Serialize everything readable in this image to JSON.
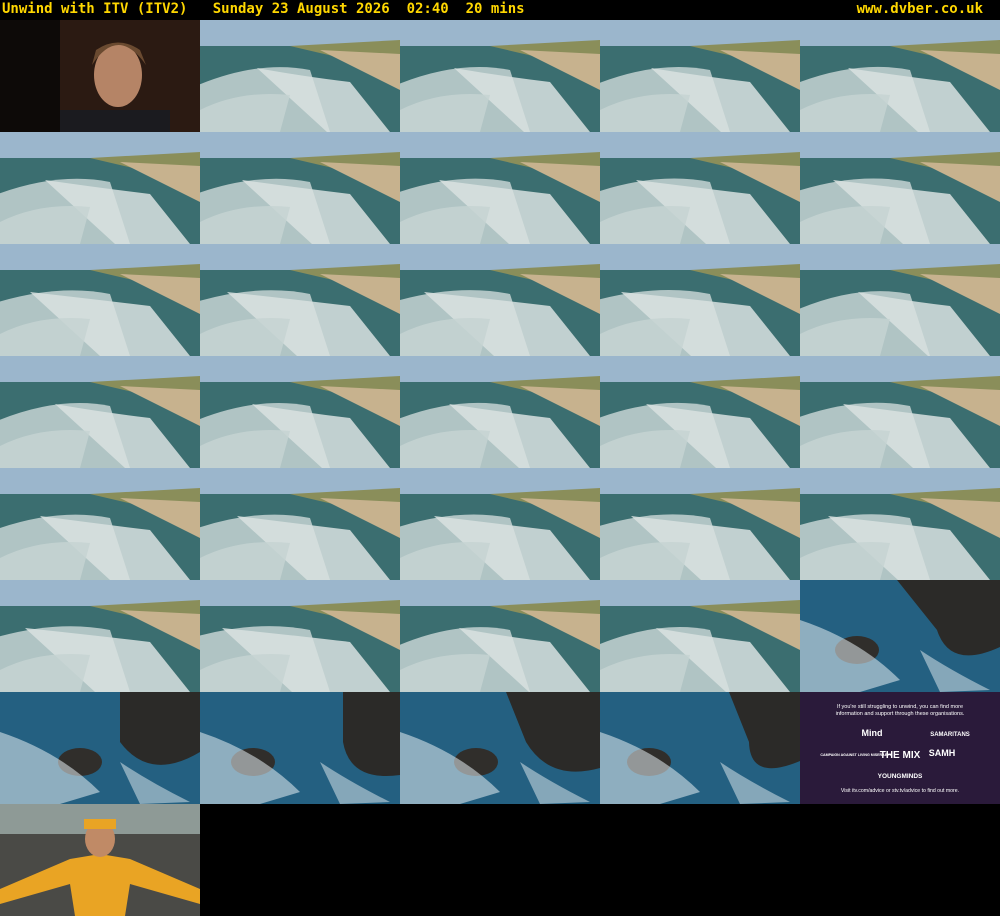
{
  "header": {
    "title": "Unwind with ITV (ITV2)   Sunday 23 August 2026  02:40  20 mins",
    "site": "www.dvber.co.uk",
    "color": "#ffd700"
  },
  "thumbnails": [
    {
      "scene": "woman-portrait"
    },
    {
      "scene": "aerial-beach-waves"
    },
    {
      "scene": "aerial-beach-waves"
    },
    {
      "scene": "aerial-beach-waves"
    },
    {
      "scene": "aerial-beach-waves"
    },
    {
      "scene": "aerial-beach-waves"
    },
    {
      "scene": "aerial-beach-waves"
    },
    {
      "scene": "aerial-beach-waves"
    },
    {
      "scene": "aerial-beach-waves"
    },
    {
      "scene": "aerial-beach-waves"
    },
    {
      "scene": "aerial-beach-waves"
    },
    {
      "scene": "aerial-beach-waves"
    },
    {
      "scene": "aerial-beach-waves"
    },
    {
      "scene": "aerial-beach-waves"
    },
    {
      "scene": "aerial-beach-waves"
    },
    {
      "scene": "aerial-beach-waves"
    },
    {
      "scene": "aerial-beach-waves"
    },
    {
      "scene": "aerial-beach-waves"
    },
    {
      "scene": "aerial-beach-waves"
    },
    {
      "scene": "aerial-beach-waves"
    },
    {
      "scene": "aerial-beach-waves"
    },
    {
      "scene": "aerial-beach-waves"
    },
    {
      "scene": "aerial-beach-waves"
    },
    {
      "scene": "aerial-beach-waves"
    },
    {
      "scene": "aerial-beach-waves"
    },
    {
      "scene": "aerial-beach-waves"
    },
    {
      "scene": "aerial-beach-waves"
    },
    {
      "scene": "aerial-beach-waves"
    },
    {
      "scene": "aerial-beach-waves"
    },
    {
      "scene": "rocks-surf"
    },
    {
      "scene": "rocks-surf"
    },
    {
      "scene": "rocks-surf"
    },
    {
      "scene": "rocks-surf"
    },
    {
      "scene": "rocks-surf"
    },
    {
      "scene": "charity-advice-card",
      "lines": [
        "If you're still struggling to unwind, you can find more",
        "information and support through these organisations.",
        "Visit itv.com/advice or stv.tv/advice to find out more."
      ],
      "logos": [
        "Mind",
        "SAMARITANS",
        "CAMPAIGN AGAINST LIVING MISERABLY",
        "THE MIX",
        "SAMH",
        "YOUNGMINDS"
      ]
    },
    {
      "scene": "man-yellow-coat"
    }
  ]
}
